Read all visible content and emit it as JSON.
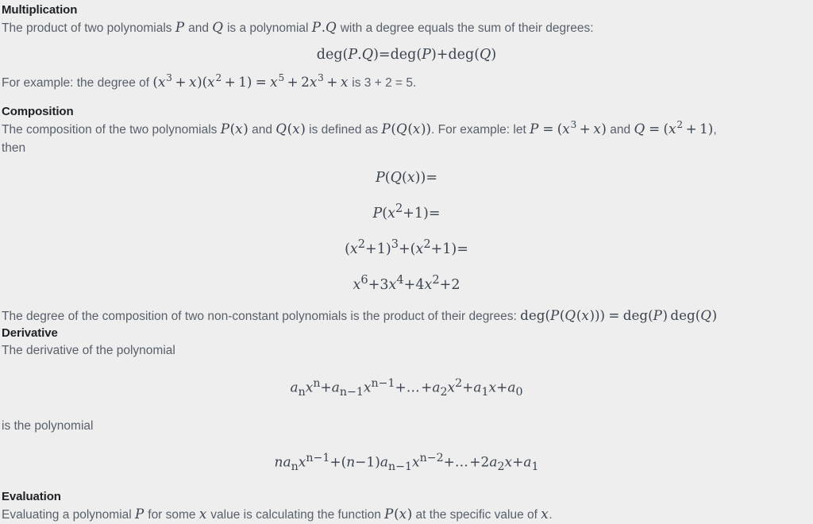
{
  "document": {
    "background_color": "#eeeeee",
    "body_text_color": "#58606b",
    "heading_color": "#1d2024",
    "math_color": "#3b4450"
  },
  "sections": {
    "multiplication": {
      "heading": "Multiplication",
      "intro_before_p": "The product of two polynomials ",
      "intro_p": "P",
      "intro_and": " and ",
      "intro_q": "Q",
      "intro_mid": " is a polynomial ",
      "intro_pq": "P.Q",
      "intro_after": " with a degree equals the sum of their degrees:",
      "equation": {
        "lhs_fn": "deg",
        "lhs_arg": "P.Q",
        "relation": "=",
        "rhs_fn1": "deg",
        "rhs_arg1": "P",
        "plus": "+",
        "rhs_fn2": "deg",
        "rhs_arg2": "Q",
        "plain": "deg(P.Q) = deg(P) + deg(Q)"
      },
      "example_prefix": "For example: the degree of ",
      "example_math": "(x³ + x)(x² + 1) = x⁵ + 2x³ + x",
      "example_suffix": " is 3 + 2 = 5."
    },
    "composition": {
      "heading": "Composition",
      "intro_a": "The composition of the two polynomials ",
      "intro_px": "P(x)",
      "intro_b": " and ",
      "intro_qx": "Q(x)",
      "intro_c": " is defined as ",
      "intro_pqx": "P(Q(x))",
      "intro_d": ". For example: let ",
      "intro_p_def": "P = (x³ + x)",
      "intro_e": " and ",
      "intro_q_def": "Q = (x² + 1)",
      "intro_f": ",",
      "then": "then",
      "equations": [
        "P(Q(x)) =",
        "P(x² + 1) =",
        "(x² + 1)³ + (x² + 1) =",
        "x⁶ + 3x⁴ + 4x² + 2"
      ],
      "degree_note_prefix": "The degree of the composition of two non-constant polynomials is the product of their degrees: ",
      "degree_note_math": "deg(P(Q(x))) = deg(P) deg(Q)"
    },
    "derivative": {
      "heading": "Derivative",
      "intro": "The derivative of the polynomial",
      "polynomial": "aₙxⁿ + aₙ₋₁xⁿ⁻¹ + … + a₂x² + a₁x + a₀",
      "middle_text": "is the polynomial",
      "derivative_formula": "naₙxⁿ⁻¹ + (n − 1)aₙ₋₁xⁿ⁻²+…+2a₂x + a₁"
    },
    "evaluation": {
      "heading": "Evaluation",
      "text_a": "Evaluating a polynomial ",
      "text_p": "P",
      "text_b": " for some ",
      "text_x": "x",
      "text_c": " value is calculating the function ",
      "text_px": "P(x)",
      "text_d": " at the specific value of ",
      "text_x2": "x",
      "text_e": "."
    }
  }
}
